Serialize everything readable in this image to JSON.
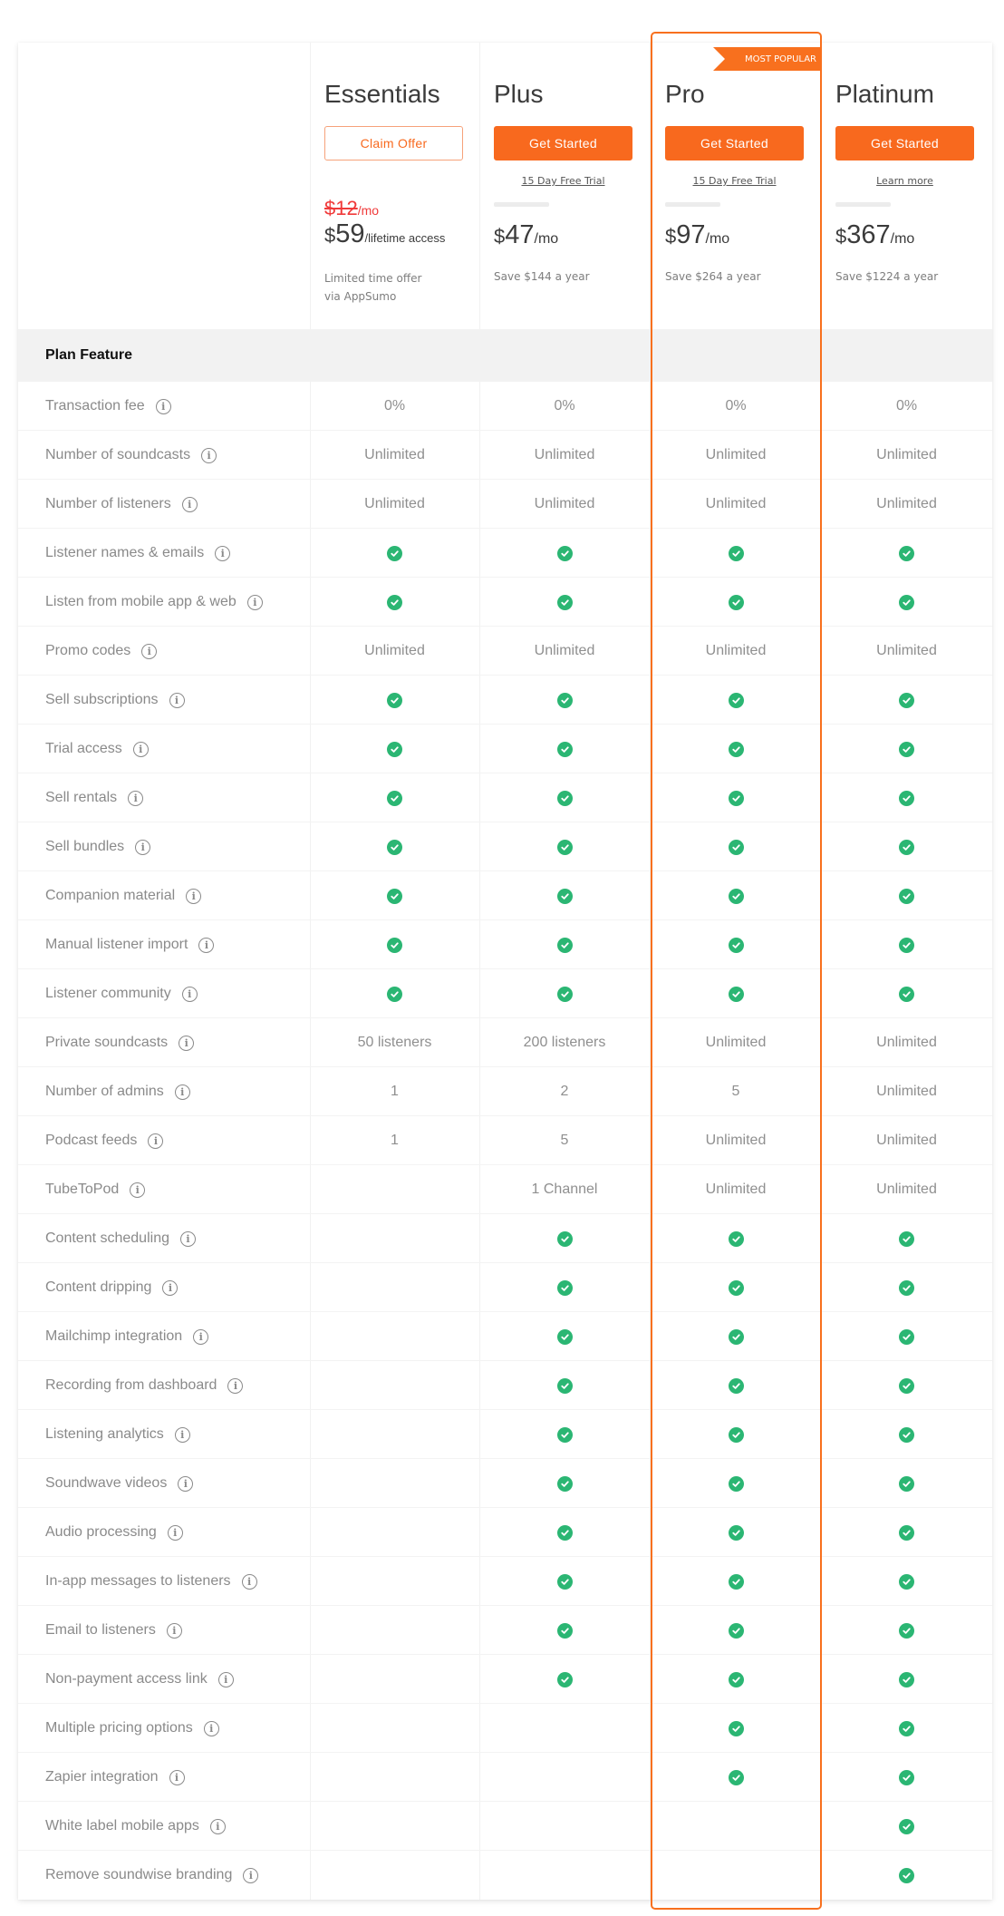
{
  "colors": {
    "accent": "#f8691e",
    "check": "#2bb673",
    "strike_price": "#f03a3a",
    "band_bg": "#f2f2f2"
  },
  "badge": {
    "label": "MOST POPULAR",
    "plan": "Pro"
  },
  "plans": [
    {
      "name": "Essentials",
      "button_label": "Claim Offer",
      "button_style": "outline",
      "old_price": {
        "amount": "$12",
        "period": "/mo"
      },
      "price": {
        "currency": "$",
        "amount": "59",
        "period": "/lifetime access"
      },
      "note_line1": "Limited time offer",
      "note_line2": "via AppSumo"
    },
    {
      "name": "Plus",
      "button_label": "Get Started",
      "button_style": "solid",
      "link_label": "15 Day Free Trial",
      "price": {
        "currency": "$",
        "amount": "47",
        "period": "/mo"
      },
      "savings": "Save $144 a year"
    },
    {
      "name": "Pro",
      "button_label": "Get Started",
      "button_style": "solid",
      "link_label": "15 Day Free Trial",
      "price": {
        "currency": "$",
        "amount": "97",
        "period": "/mo"
      },
      "savings": "Save $264 a year"
    },
    {
      "name": "Platinum",
      "button_label": "Get Started",
      "button_style": "solid",
      "link_label": "Learn more",
      "price": {
        "currency": "$",
        "amount": "367",
        "period": "/mo"
      },
      "savings": "Save $1224 a year"
    }
  ],
  "feature_header": "Plan Feature",
  "features": [
    {
      "name": "Transaction fee",
      "values": [
        "0%",
        "0%",
        "0%",
        "0%"
      ]
    },
    {
      "name": "Number of soundcasts",
      "values": [
        "Unlimited",
        "Unlimited",
        "Unlimited",
        "Unlimited"
      ]
    },
    {
      "name": "Number of listeners",
      "values": [
        "Unlimited",
        "Unlimited",
        "Unlimited",
        "Unlimited"
      ]
    },
    {
      "name": "Listener names & emails",
      "values": [
        true,
        true,
        true,
        true
      ]
    },
    {
      "name": "Listen from mobile app & web",
      "values": [
        true,
        true,
        true,
        true
      ]
    },
    {
      "name": "Promo codes",
      "values": [
        "Unlimited",
        "Unlimited",
        "Unlimited",
        "Unlimited"
      ]
    },
    {
      "name": "Sell subscriptions",
      "values": [
        true,
        true,
        true,
        true
      ]
    },
    {
      "name": "Trial access",
      "values": [
        true,
        true,
        true,
        true
      ]
    },
    {
      "name": "Sell rentals",
      "values": [
        true,
        true,
        true,
        true
      ]
    },
    {
      "name": "Sell bundles",
      "values": [
        true,
        true,
        true,
        true
      ]
    },
    {
      "name": "Companion material",
      "values": [
        true,
        true,
        true,
        true
      ]
    },
    {
      "name": "Manual listener import",
      "values": [
        true,
        true,
        true,
        true
      ]
    },
    {
      "name": "Listener community",
      "values": [
        true,
        true,
        true,
        true
      ]
    },
    {
      "name": "Private soundcasts",
      "values": [
        "50 listeners",
        "200 listeners",
        "Unlimited",
        "Unlimited"
      ]
    },
    {
      "name": "Number of admins",
      "values": [
        "1",
        "2",
        "5",
        "Unlimited"
      ]
    },
    {
      "name": "Podcast feeds",
      "values": [
        "1",
        "5",
        "Unlimited",
        "Unlimited"
      ]
    },
    {
      "name": "TubeToPod",
      "values": [
        "",
        "1 Channel",
        "Unlimited",
        "Unlimited"
      ]
    },
    {
      "name": "Content scheduling",
      "values": [
        false,
        true,
        true,
        true
      ]
    },
    {
      "name": "Content dripping",
      "values": [
        false,
        true,
        true,
        true
      ]
    },
    {
      "name": "Mailchimp integration",
      "values": [
        false,
        true,
        true,
        true
      ]
    },
    {
      "name": "Recording from dashboard",
      "values": [
        false,
        true,
        true,
        true
      ]
    },
    {
      "name": "Listening analytics",
      "values": [
        false,
        true,
        true,
        true
      ]
    },
    {
      "name": "Soundwave videos",
      "values": [
        false,
        true,
        true,
        true
      ]
    },
    {
      "name": "Audio processing",
      "values": [
        false,
        true,
        true,
        true
      ]
    },
    {
      "name": "In-app messages to listeners",
      "values": [
        false,
        true,
        true,
        true
      ]
    },
    {
      "name": "Email to listeners",
      "values": [
        false,
        true,
        true,
        true
      ]
    },
    {
      "name": "Non-payment access link",
      "values": [
        false,
        true,
        true,
        true
      ]
    },
    {
      "name": "Multiple pricing options",
      "values": [
        false,
        false,
        true,
        true
      ]
    },
    {
      "name": "Zapier integration",
      "values": [
        false,
        false,
        true,
        true
      ]
    },
    {
      "name": "White label mobile apps",
      "values": [
        false,
        false,
        false,
        true
      ]
    },
    {
      "name": "Remove soundwise branding",
      "values": [
        false,
        false,
        false,
        true
      ]
    }
  ]
}
